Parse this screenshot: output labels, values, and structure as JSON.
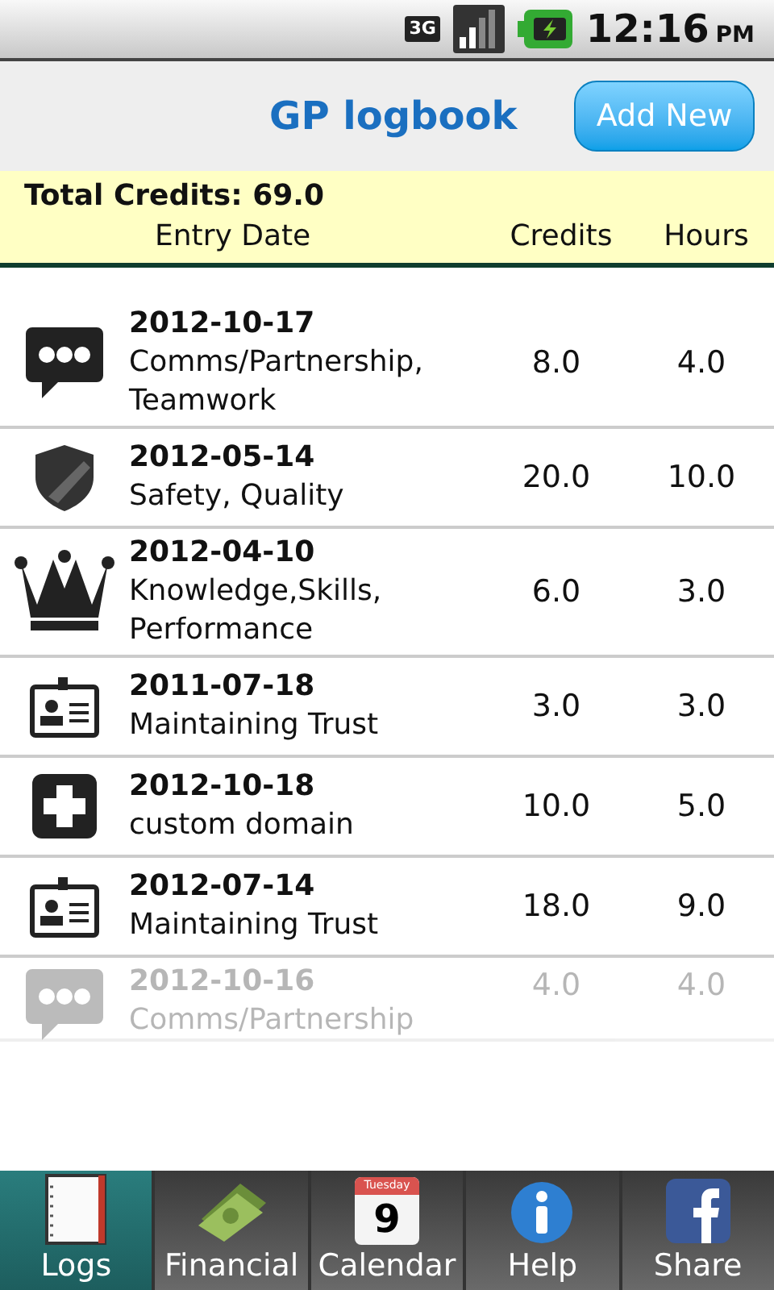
{
  "status_bar": {
    "network": "3G",
    "time": "12:16",
    "period": "PM"
  },
  "header": {
    "title": "GP logbook",
    "add_button": "Add New"
  },
  "summary": {
    "total": "Total Credits: 69.0",
    "columns": [
      "Entry Date",
      "Credits",
      "Hours"
    ]
  },
  "entries": [
    {
      "kind": "chat",
      "date": "2012-10-17",
      "domain": "Comms/Partnership, Teamwork",
      "credits": "8.0",
      "hours": "4.0",
      "faded": false
    },
    {
      "kind": "shield",
      "date": "2012-05-14",
      "domain": "Safety, Quality",
      "credits": "20.0",
      "hours": "10.0",
      "faded": false
    },
    {
      "kind": "crown",
      "date": "2012-04-10",
      "domain": "Knowledge,Skills, Performance",
      "credits": "6.0",
      "hours": "3.0",
      "faded": false
    },
    {
      "kind": "badge",
      "date": "2011-07-18",
      "domain": "Maintaining Trust",
      "credits": "3.0",
      "hours": "3.0",
      "faded": false
    },
    {
      "kind": "plus",
      "date": "2012-10-18",
      "domain": "custom domain",
      "credits": "10.0",
      "hours": "5.0",
      "faded": false
    },
    {
      "kind": "badge",
      "date": "2012-07-14",
      "domain": "Maintaining Trust",
      "credits": "18.0",
      "hours": "9.0",
      "faded": false
    },
    {
      "kind": "chat",
      "date": "2012-10-16",
      "domain": "Comms/Partnership",
      "credits": "4.0",
      "hours": "4.0",
      "faded": true
    }
  ],
  "tabs": [
    {
      "kind": "notebook",
      "label": "Logs",
      "selected": true
    },
    {
      "kind": "money",
      "label": "Financial",
      "selected": false
    },
    {
      "kind": "calendar",
      "label": "Calendar",
      "selected": false,
      "calendar_day": "Tuesday",
      "calendar_date": "9"
    },
    {
      "kind": "info",
      "label": "Help",
      "selected": false
    },
    {
      "kind": "facebook",
      "label": "Share",
      "selected": false
    }
  ]
}
